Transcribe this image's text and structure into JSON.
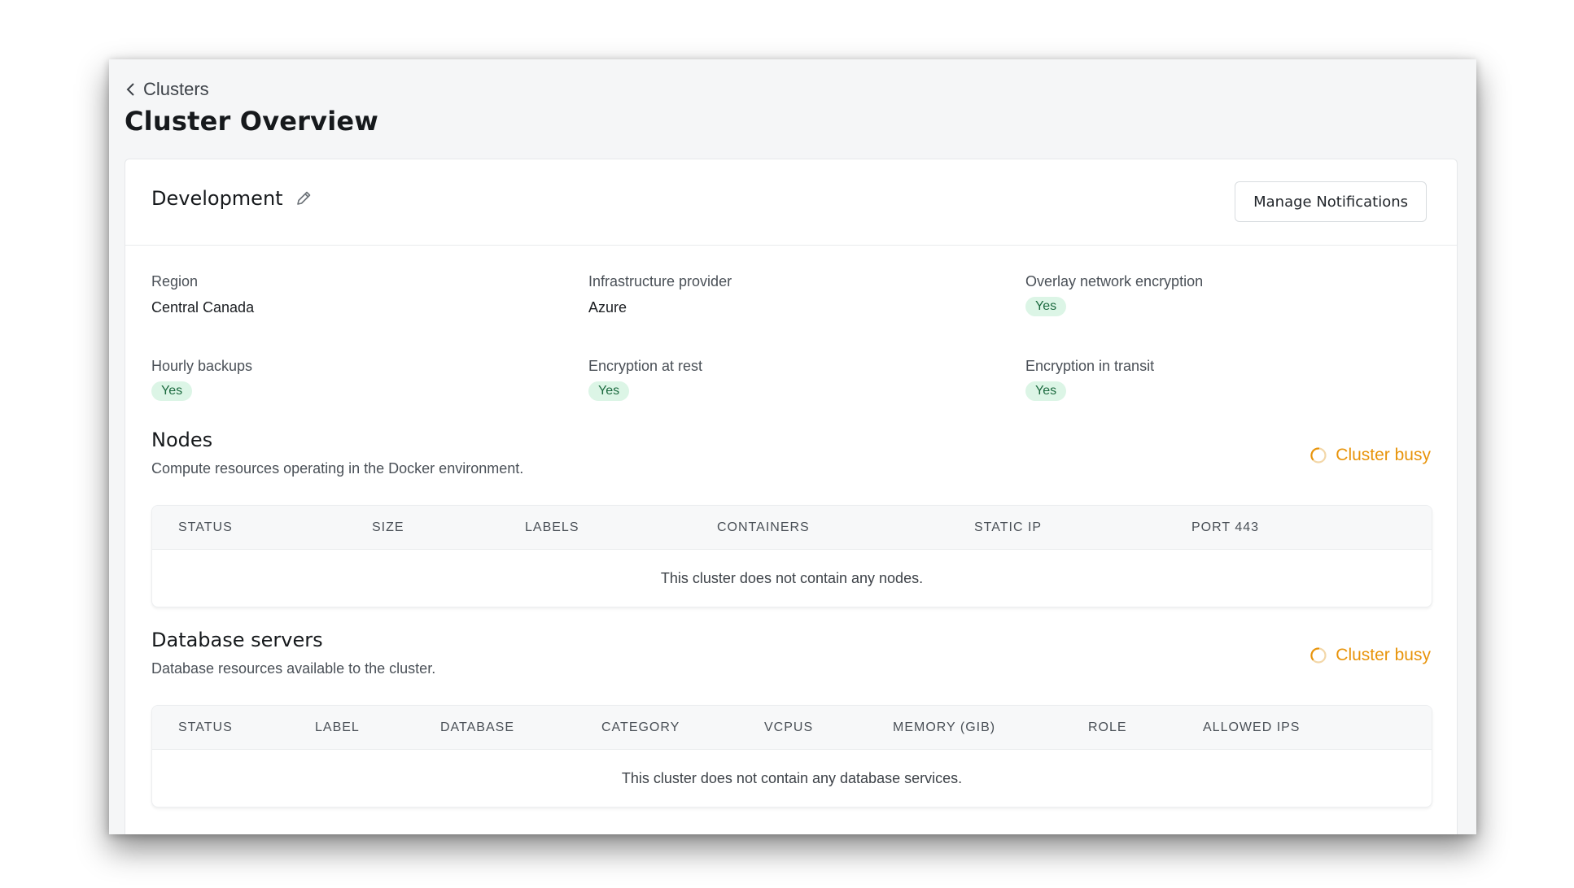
{
  "breadcrumb": {
    "back_label": "Clusters"
  },
  "page_title": "Cluster Overview",
  "cluster": {
    "name": "Development",
    "manage_button": "Manage Notifications"
  },
  "details": [
    {
      "label": "Region",
      "value": "Central Canada",
      "badge": ""
    },
    {
      "label": "Infrastructure provider",
      "value": "Azure",
      "badge": ""
    },
    {
      "label": "Overlay network encryption",
      "value": "",
      "badge": "Yes"
    },
    {
      "label": "Hourly backups",
      "value": "",
      "badge": "Yes"
    },
    {
      "label": "Encryption at rest",
      "value": "",
      "badge": "Yes"
    },
    {
      "label": "Encryption in transit",
      "value": "",
      "badge": "Yes"
    }
  ],
  "nodes": {
    "title": "Nodes",
    "description": "Compute resources operating in the Docker environment.",
    "status": "Cluster busy",
    "columns": [
      "STATUS",
      "SIZE",
      "LABELS",
      "CONTAINERS",
      "STATIC IP",
      "PORT 443"
    ],
    "empty_message": "This cluster does not contain any nodes."
  },
  "databases": {
    "title": "Database servers",
    "description": "Database resources available to the cluster.",
    "status": "Cluster busy",
    "columns": [
      "STATUS",
      "LABEL",
      "DATABASE",
      "CATEGORY",
      "VCPUS",
      "MEMORY (GIB)",
      "ROLE",
      "ALLOWED IPS"
    ],
    "empty_message": "This cluster does not contain any database services."
  },
  "colors": {
    "busy": "#e8940b",
    "badge_bg": "#dcf5e6",
    "badge_text": "#1c6a3f"
  },
  "icons": [
    "chevron-left-icon",
    "pencil-icon",
    "spinner-icon"
  ]
}
